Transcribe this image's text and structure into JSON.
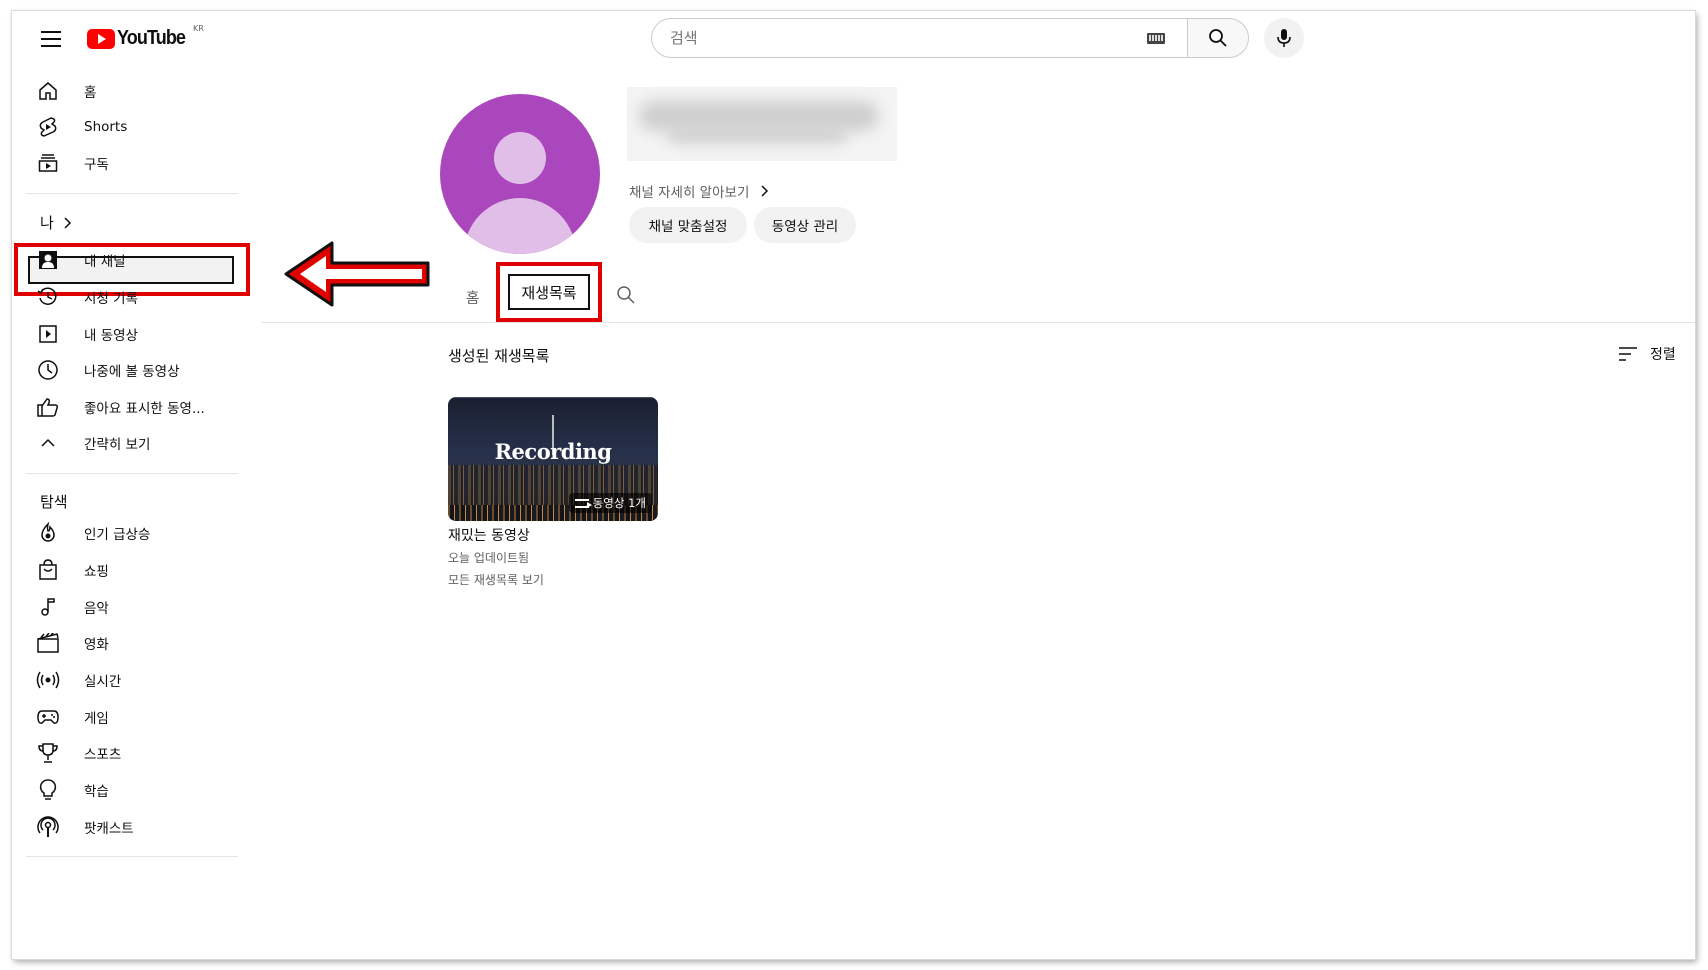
{
  "header": {
    "logo_text": "YouTube",
    "region": "KR",
    "search_placeholder": "검색"
  },
  "sidebar": {
    "top_items": [
      {
        "label": "홈",
        "icon": "home-icon"
      },
      {
        "label": "Shorts",
        "icon": "shorts-icon"
      },
      {
        "label": "구독",
        "icon": "subscriptions-icon"
      }
    ],
    "you_section": {
      "title": "나",
      "items": [
        {
          "label": "내 채널",
          "icon": "my-channel-icon",
          "selected": true
        },
        {
          "label": "시청 기록",
          "icon": "history-icon"
        },
        {
          "label": "내 동영상",
          "icon": "my-videos-icon"
        },
        {
          "label": "나중에 볼 동영상",
          "icon": "watch-later-icon"
        },
        {
          "label": "좋아요 표시한 동영...",
          "icon": "like-icon"
        },
        {
          "label": "간략히 보기",
          "icon": "chevron-up-icon"
        }
      ]
    },
    "explore_section": {
      "title": "탐색",
      "items": [
        {
          "label": "인기 급상승",
          "icon": "trending-icon"
        },
        {
          "label": "쇼핑",
          "icon": "shopping-bag-icon"
        },
        {
          "label": "음악",
          "icon": "music-note-icon"
        },
        {
          "label": "영화",
          "icon": "film-icon"
        },
        {
          "label": "실시간",
          "icon": "live-icon"
        },
        {
          "label": "게임",
          "icon": "gamepad-icon"
        },
        {
          "label": "스포츠",
          "icon": "trophy-icon"
        },
        {
          "label": "학습",
          "icon": "lightbulb-icon"
        },
        {
          "label": "팟캐스트",
          "icon": "podcast-icon"
        }
      ]
    }
  },
  "channel": {
    "about_link": "채널 자세히 알아보기",
    "buttons": {
      "customize": "채널 맞춤설정",
      "manage_videos": "동영상 관리"
    },
    "avatar_color": "#ab47bc"
  },
  "tabs": {
    "home": "홈",
    "playlists": "재생목록",
    "active": "playlists"
  },
  "content": {
    "shelf_title": "생성된 재생목록",
    "sort_label": "정렬",
    "playlist": {
      "thumbnail_text": "Recording",
      "count_label": "동영상 1개",
      "title": "재밌는 동영상",
      "updated": "오늘 업데이트됨",
      "view_all": "모든 재생목록 보기"
    }
  },
  "annotation_color": "#e00000"
}
